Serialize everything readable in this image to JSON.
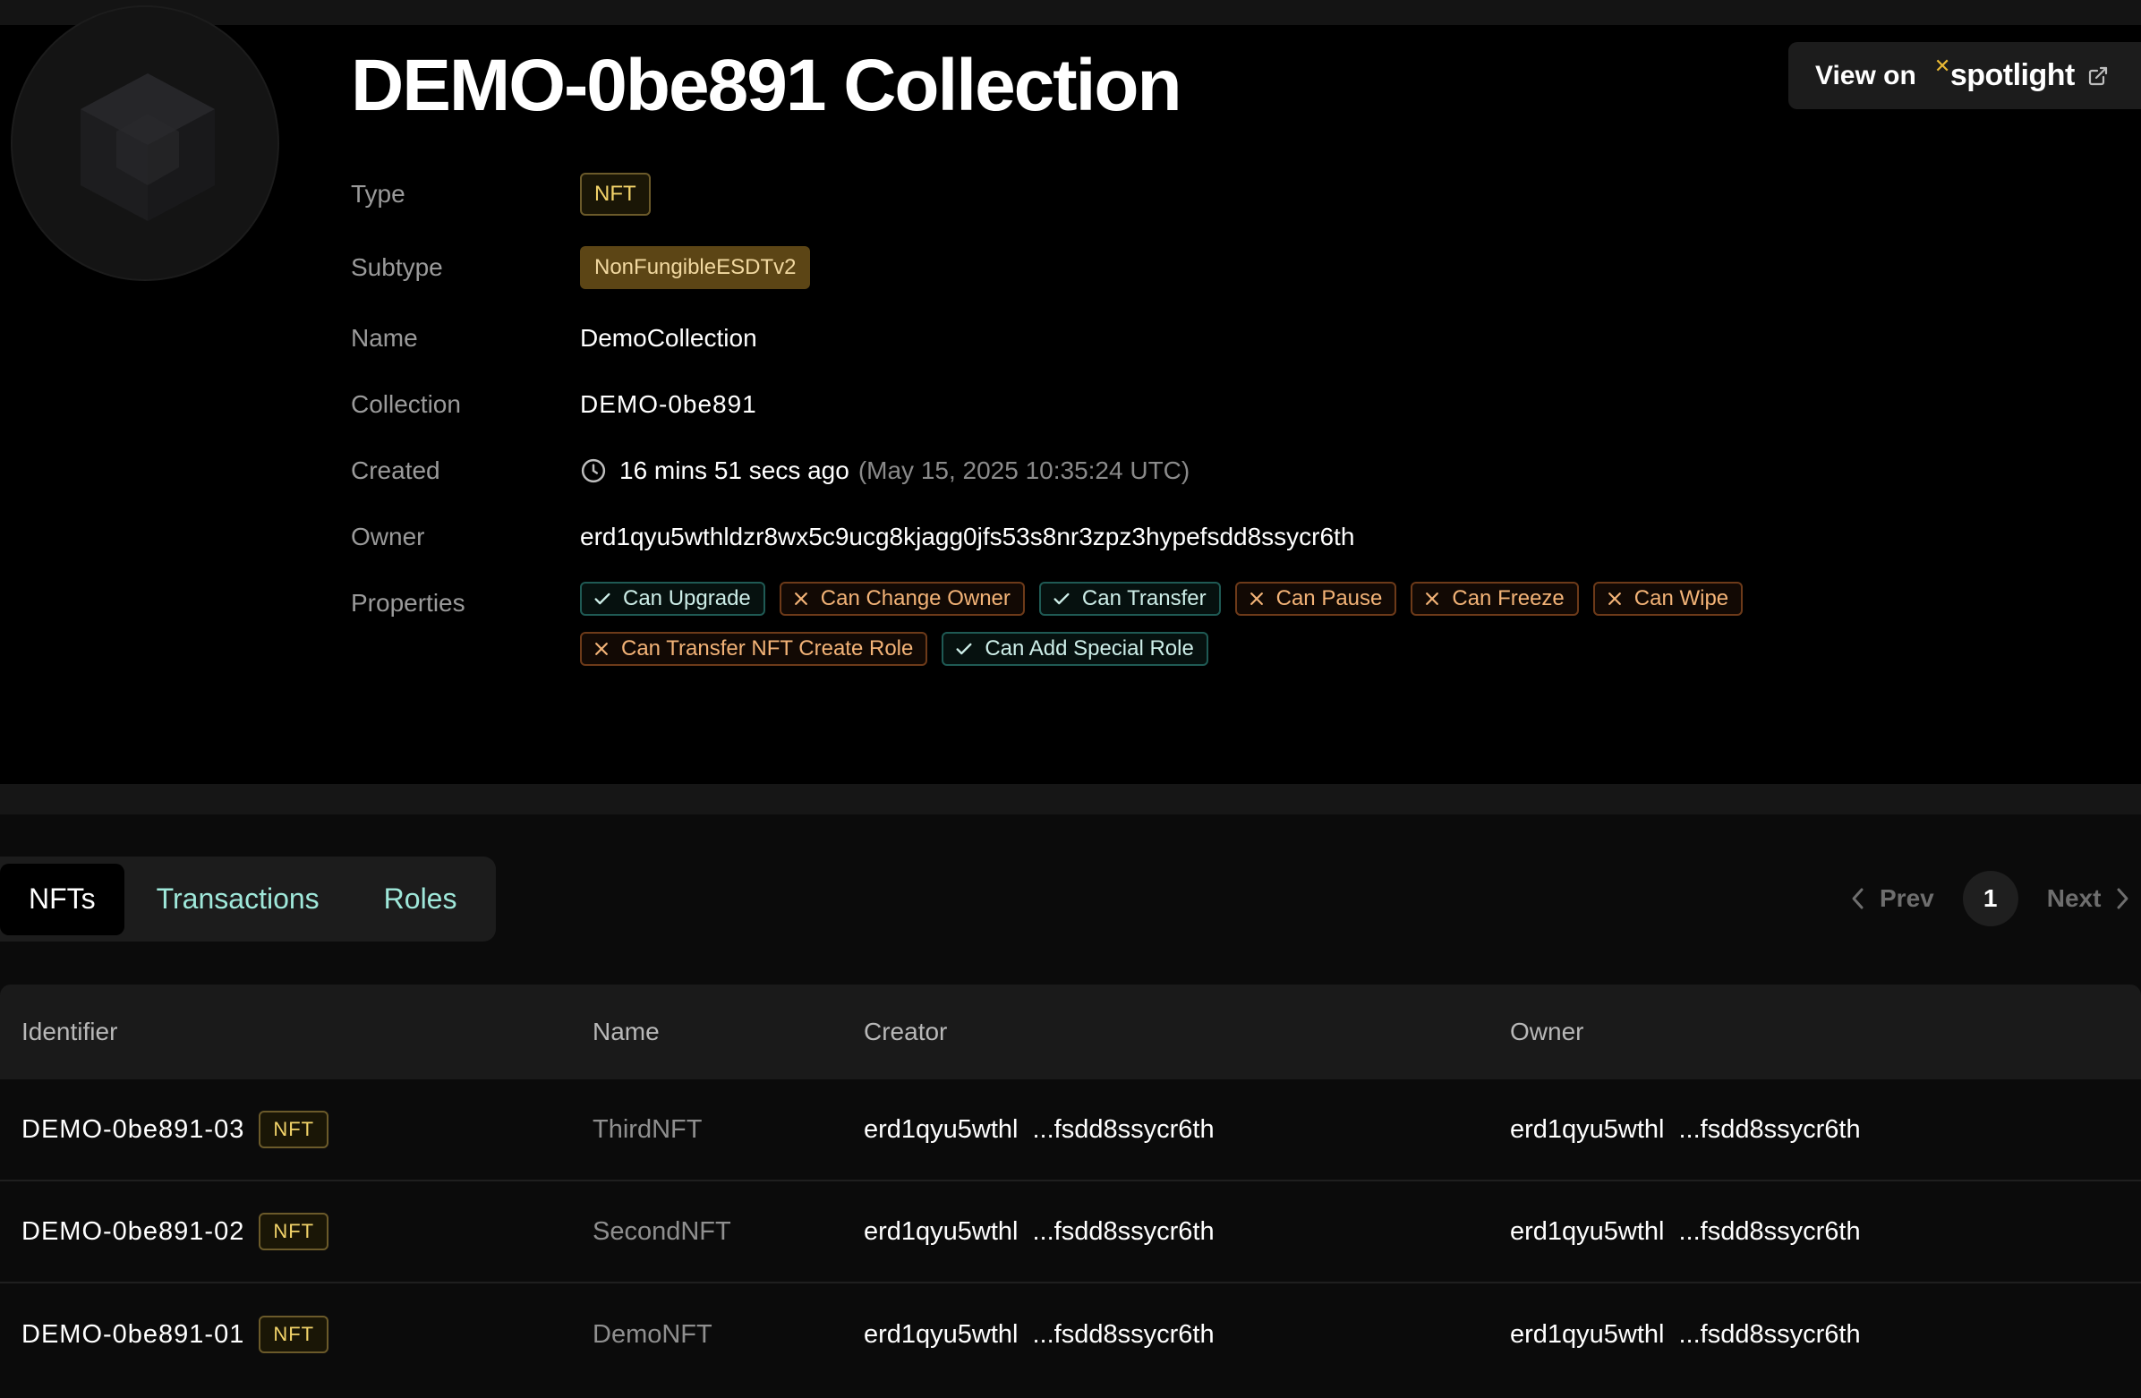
{
  "page": {
    "title": "DEMO-0be891 Collection"
  },
  "view_on": {
    "label": "View on",
    "brand": "spotlight",
    "brand_accent": "#e9b935"
  },
  "details": {
    "type": {
      "label": "Type",
      "value": "NFT"
    },
    "subtype": {
      "label": "Subtype",
      "value": "NonFungibleESDTv2"
    },
    "name": {
      "label": "Name",
      "value": "DemoCollection"
    },
    "collection": {
      "label": "Collection",
      "value": "DEMO-0be891"
    },
    "created": {
      "label": "Created",
      "relative": "16 mins 51 secs ago",
      "absolute": "(May 15, 2025 10:35:24 UTC)"
    },
    "owner": {
      "label": "Owner",
      "value": "erd1qyu5wthldzr8wx5c9ucg8kjagg0jfs53s8nr3zpz3hypefsdd8ssycr6th"
    },
    "properties_label": "Properties"
  },
  "properties": [
    {
      "label": "Can Upgrade",
      "enabled": true
    },
    {
      "label": "Can Change Owner",
      "enabled": false
    },
    {
      "label": "Can Transfer",
      "enabled": true
    },
    {
      "label": "Can Pause",
      "enabled": false
    },
    {
      "label": "Can Freeze",
      "enabled": false
    },
    {
      "label": "Can Wipe",
      "enabled": false
    },
    {
      "label": "Can Transfer NFT Create Role",
      "enabled": false
    },
    {
      "label": "Can Add Special Role",
      "enabled": true
    }
  ],
  "tabs": [
    {
      "label": "NFTs",
      "active": true
    },
    {
      "label": "Transactions",
      "active": false
    },
    {
      "label": "Roles",
      "active": false
    }
  ],
  "pager": {
    "prev": "Prev",
    "page": "1",
    "next": "Next"
  },
  "table": {
    "headers": {
      "identifier": "Identifier",
      "name": "Name",
      "creator": "Creator",
      "owner": "Owner"
    },
    "rows": [
      {
        "identifier": "DEMO-0be891-03",
        "badge": "NFT",
        "name": "ThirdNFT",
        "creator_start": "erd1qyu5wthl",
        "creator_end": "...fsdd8ssycr6th",
        "owner_start": "erd1qyu5wthl",
        "owner_end": "...fsdd8ssycr6th"
      },
      {
        "identifier": "DEMO-0be891-02",
        "badge": "NFT",
        "name": "SecondNFT",
        "creator_start": "erd1qyu5wthl",
        "creator_end": "...fsdd8ssycr6th",
        "owner_start": "erd1qyu5wthl",
        "owner_end": "...fsdd8ssycr6th"
      },
      {
        "identifier": "DEMO-0be891-01",
        "badge": "NFT",
        "name": "DemoNFT",
        "creator_start": "erd1qyu5wthl",
        "creator_end": "...fsdd8ssycr6th",
        "owner_start": "erd1qyu5wthl",
        "owner_end": "...fsdd8ssycr6th"
      }
    ]
  }
}
